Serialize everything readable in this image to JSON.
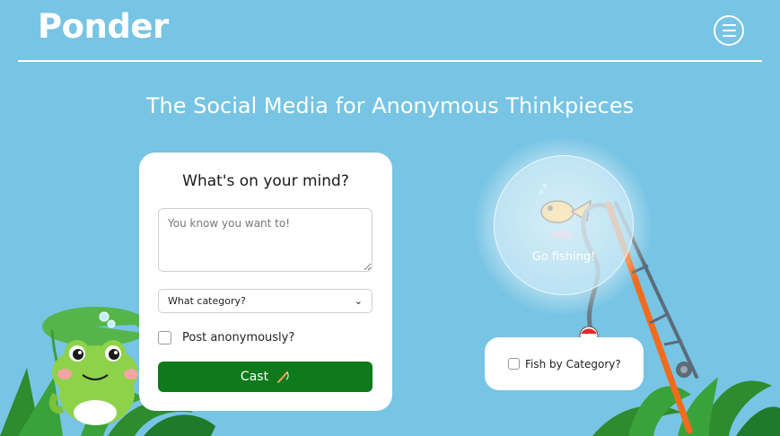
{
  "header": {
    "logo": "Ponder",
    "menu_icon": "hamburger-icon"
  },
  "hero": {
    "tagline": "The Social Media for Anonymous Thinkpieces"
  },
  "post_form": {
    "heading": "What's on your mind?",
    "thought_placeholder": "You know you want to!",
    "thought_value": "",
    "category_selected": "What category?",
    "anonymous_label": "Post anonymously?",
    "anonymous_checked": false,
    "cast_label": "Cast",
    "cast_icon": "fishing-rod-icon"
  },
  "fishing": {
    "bubble_label": "Go fishing!",
    "fish_by_category_label": "Fish by Category?",
    "fish_by_category_checked": false
  },
  "colors": {
    "background": "#77c4e4",
    "cast_button": "#0e7a1c",
    "frog": "#8ed24a",
    "rod": "#f26b1d"
  }
}
